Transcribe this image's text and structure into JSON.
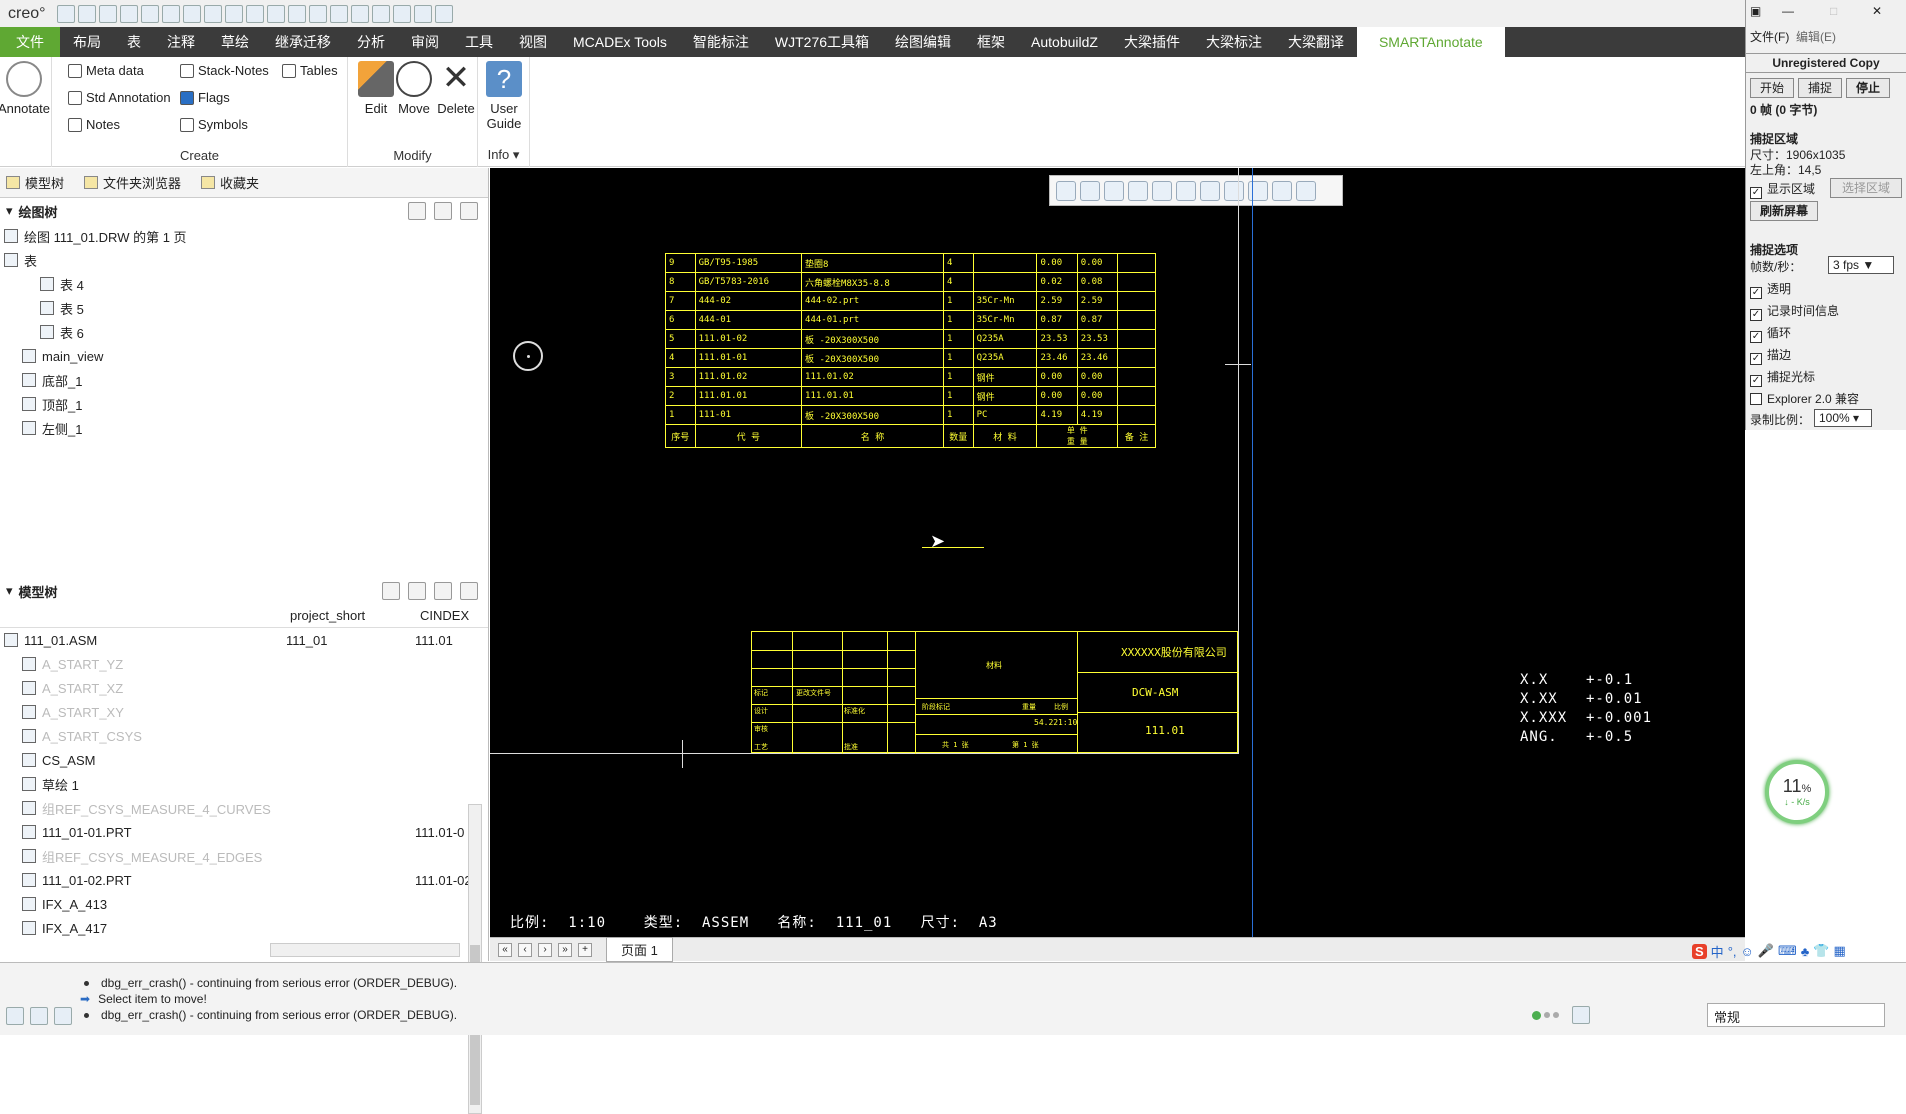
{
  "app": {
    "logo": "creo°"
  },
  "tabs": [
    {
      "label": "文件",
      "kind": "file"
    },
    {
      "label": "布局"
    },
    {
      "label": "表"
    },
    {
      "label": "注释"
    },
    {
      "label": "草绘"
    },
    {
      "label": "继承迁移"
    },
    {
      "label": "分析"
    },
    {
      "label": "审阅"
    },
    {
      "label": "工具"
    },
    {
      "label": "视图"
    },
    {
      "label": "MCADEx Tools"
    },
    {
      "label": "智能标注"
    },
    {
      "label": "WJT276工具箱"
    },
    {
      "label": "绘图编辑"
    },
    {
      "label": "框架"
    },
    {
      "label": "AutobuildZ"
    },
    {
      "label": "大梁插件"
    },
    {
      "label": "大梁标注"
    },
    {
      "label": "大梁翻译"
    },
    {
      "label": "SMARTAnnotate",
      "kind": "active"
    }
  ],
  "ribbon": {
    "annotate_label": "Annotate",
    "create": {
      "label": "Create",
      "meta": "Meta data",
      "stack": "Stack-Notes",
      "tables": "Tables",
      "std": "Std Annotation",
      "flags": "Flags",
      "notes": "Notes",
      "symbols": "Symbols"
    },
    "modify": {
      "label": "Modify",
      "edit": "Edit",
      "move": "Move",
      "delete": "Delete"
    },
    "info": {
      "label": "Info ▾",
      "guide1": "User",
      "guide2": "Guide"
    }
  },
  "nav_tabs": [
    "模型树",
    "文件夹浏览器",
    "收藏夹"
  ],
  "drawing_tree": {
    "title": "绘图树",
    "root": "绘图 111_01.DRW 的第 1 页",
    "tables_label": "表",
    "tables": [
      "表 4",
      "表 5",
      "表 6"
    ],
    "views": [
      "main_view",
      "底部_1",
      "顶部_1",
      "左侧_1"
    ]
  },
  "model_tree": {
    "title": "模型树",
    "columns": [
      "project_short",
      "CINDEX"
    ],
    "rows": [
      {
        "name": "111_01.ASM",
        "c1": "111_01",
        "c2": "111.01",
        "dim": false
      },
      {
        "name": "A_START_YZ",
        "c1": "",
        "c2": "",
        "dim": true
      },
      {
        "name": "A_START_XZ",
        "c1": "",
        "c2": "",
        "dim": true
      },
      {
        "name": "A_START_XY",
        "c1": "",
        "c2": "",
        "dim": true
      },
      {
        "name": "A_START_CSYS",
        "c1": "",
        "c2": "",
        "dim": true
      },
      {
        "name": "CS_ASM",
        "c1": "",
        "c2": "",
        "dim": false
      },
      {
        "name": "草绘 1",
        "c1": "",
        "c2": "",
        "dim": false
      },
      {
        "name": "组REF_CSYS_MEASURE_4_CURVES",
        "c1": "",
        "c2": "",
        "dim": true
      },
      {
        "name": "111_01-01.PRT",
        "c1": "",
        "c2": "111.01-0",
        "dim": false
      },
      {
        "name": "组REF_CSYS_MEASURE_4_EDGES",
        "c1": "",
        "c2": "",
        "dim": true
      },
      {
        "name": "111_01-02.PRT",
        "c1": "",
        "c2": "111.01-02",
        "dim": false
      },
      {
        "name": "IFX_A_413",
        "c1": "",
        "c2": "",
        "dim": false
      },
      {
        "name": "IFX_A_417",
        "c1": "",
        "c2": "",
        "dim": false
      }
    ]
  },
  "bom": {
    "rows": [
      [
        "9",
        "GB/T95-1985",
        "垫圈8",
        "4",
        "",
        "0.00",
        "0.00",
        ""
      ],
      [
        "8",
        "GB/T5783-2016",
        "六角螺栓M8X35-8.8",
        "4",
        "",
        "0.02",
        "0.08",
        ""
      ],
      [
        "7",
        "444-02",
        "444-02.prt",
        "1",
        "35Cr-Mn",
        "2.59",
        "2.59",
        ""
      ],
      [
        "6",
        "444-01",
        "444-01.prt",
        "1",
        "35Cr-Mn",
        "0.87",
        "0.87",
        ""
      ],
      [
        "5",
        "111.01-02",
        "板 -20X300X500",
        "1",
        "Q235A",
        "23.53",
        "23.53",
        ""
      ],
      [
        "4",
        "111.01-01",
        "板 -20X300X500",
        "1",
        "Q235A",
        "23.46",
        "23.46",
        ""
      ],
      [
        "3",
        "111.01.02",
        "111.01.02",
        "1",
        "钢件",
        "0.00",
        "0.00",
        ""
      ],
      [
        "2",
        "111.01.01",
        "111.01.01",
        "1",
        "钢件",
        "0.00",
        "0.00",
        ""
      ],
      [
        "1",
        "111-01",
        "板 -20X300X500",
        "1",
        "PC",
        "4.19",
        "4.19",
        ""
      ]
    ],
    "header": {
      "seq": "序号",
      "code": "代  号",
      "name": "名    称",
      "qty": "数量",
      "mat": "材  料",
      "single": "单 件",
      "total": "总 计",
      "weight": "重  量",
      "note": "备 注"
    }
  },
  "titleblock": {
    "company": "XXXXXX股份有限公司",
    "material": "材料",
    "drawing": "DCW-ASM",
    "number": "111.01",
    "scale": "1:10",
    "weight": "54.22",
    "mark": "标记",
    "count": "处数",
    "change": "更改文件号",
    "sign": "签名",
    "date": "日期",
    "design": "设计",
    "std": "标准化",
    "check": "审核",
    "craft": "工艺",
    "approve": "批准",
    "stage": "阶段标记",
    "wt": "重量",
    "ratio": "比例",
    "sheets": "共 1 张",
    "sheetno": "第 1 张"
  },
  "tolerances": [
    "X.X    +-0.1",
    "X.XX   +-0.01",
    "X.XXX  +-0.001",
    "ANG.   +-0.5"
  ],
  "canvas_footer": "比例:  1:10    类型:  ASSEM   名称:  111_01   尺寸:  A3",
  "page_tab": "页面 1",
  "messages": [
    {
      "text": "dbg_err_crash() - continuing from serious error (ORDER_DEBUG).",
      "kind": "dot"
    },
    {
      "text": "Select item to move!",
      "kind": "arrow"
    },
    {
      "text": "dbg_err_crash() - continuing from serious error (ORDER_DEBUG).",
      "kind": "dot"
    }
  ],
  "filter": "常规",
  "capture": {
    "menu_file": "文件(F)",
    "menu_edit": "编辑(E)",
    "unreg": "Unregistered Copy",
    "start": "开始",
    "pause": "捕捉",
    "stop": "停止",
    "frames": "0 帧 (0 字节)",
    "region_title": "捕捉区域",
    "size": "尺寸：1906x1035",
    "topleft": "左上角：14,5",
    "show_region": "显示区域",
    "select_region": "选择区域",
    "refresh": "刷新屏幕",
    "options_title": "捕捉选项",
    "fps_label": "帧数/秒：",
    "fps": "3 fps ▼",
    "transparent": "透明",
    "record_time": "记录时间信息",
    "loop": "循环",
    "border": "描边",
    "cursor": "捕捉光标",
    "explorer": "Explorer 2.0 兼容",
    "ratio_label": "录制比例：",
    "ratio": "100% ▾"
  },
  "meter": {
    "pct": "11",
    "unit": "%",
    "speed": "↓ - K/s"
  },
  "ime": [
    "S",
    "中",
    "°,",
    "☺",
    "🎤",
    "⌨",
    "♣",
    "👕",
    "▦"
  ]
}
